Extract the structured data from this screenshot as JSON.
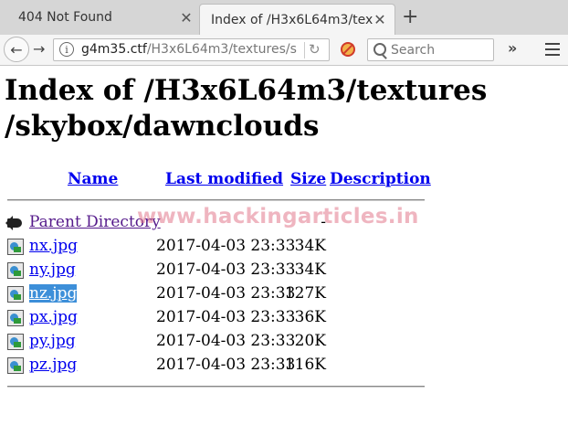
{
  "browser": {
    "tabs": [
      {
        "title": "404 Not Found",
        "active": false
      },
      {
        "title": "Index of /H3x6L64m3/tex…",
        "active": true
      }
    ],
    "url_host": "g4m35.ctf",
    "url_path": "/H3x6L64m3/textures/s",
    "search_placeholder": "Search"
  },
  "page": {
    "heading_line1": "Index of /H3x6L64m3/textures",
    "heading_line2": "/skybox/dawnclouds",
    "columns": {
      "name": "Name",
      "last_modified": "Last modified",
      "size": "Size",
      "description": "Description"
    },
    "rows": [
      {
        "name": "Parent Directory",
        "date": "",
        "size": "-",
        "icon": "back-arrow-icon"
      },
      {
        "name": "nx.jpg",
        "date": "2017-04-03 23:33",
        "size": "34K",
        "icon": "image-file-icon"
      },
      {
        "name": "ny.jpg",
        "date": "2017-04-03 23:33",
        "size": "34K",
        "icon": "image-file-icon"
      },
      {
        "name": "nz.jpg",
        "date": "2017-04-03 23:33",
        "size": "127K",
        "icon": "image-file-icon"
      },
      {
        "name": "px.jpg",
        "date": "2017-04-03 23:33",
        "size": "36K",
        "icon": "image-file-icon"
      },
      {
        "name": "py.jpg",
        "date": "2017-04-03 23:33",
        "size": "20K",
        "icon": "image-file-icon"
      },
      {
        "name": "pz.jpg",
        "date": "2017-04-03 23:33",
        "size": "116K",
        "icon": "image-file-icon"
      }
    ],
    "watermark": "www.hackingarticles.in"
  },
  "colors": {
    "link": "#0000ee",
    "visited": "#551a8b",
    "selection": "#3d8fd9",
    "watermark": "#e1788c"
  }
}
